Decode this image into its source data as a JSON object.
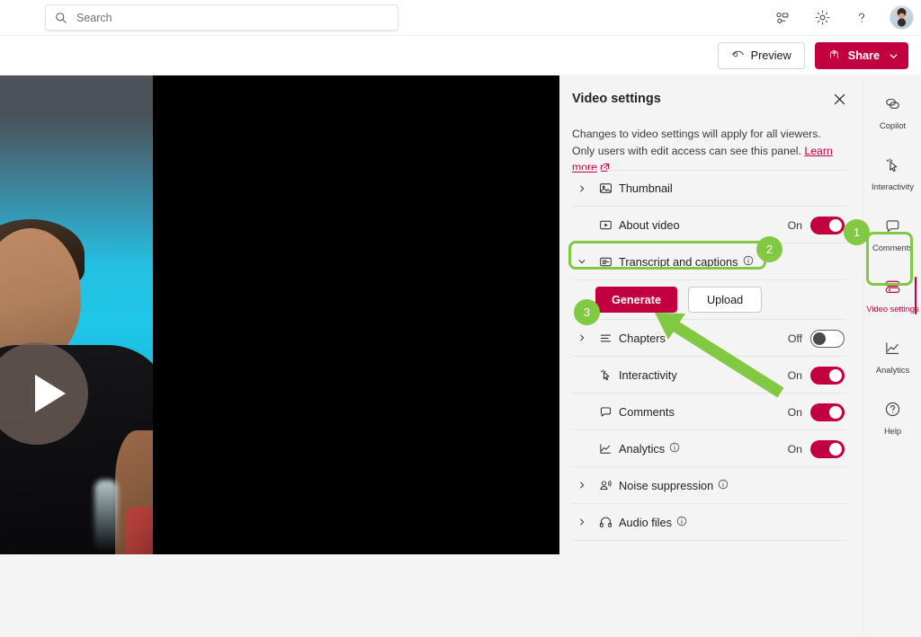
{
  "suitebar": {
    "search": {
      "placeholder": "Search",
      "value": "",
      "icon": "search-icon"
    },
    "actions": [
      {
        "name": "share-people-icon",
        "label": ""
      },
      {
        "name": "settings-gear-icon",
        "label": ""
      },
      {
        "name": "help-question-icon",
        "label": ""
      }
    ],
    "avatar": {
      "name": "user-avatar",
      "label": ""
    }
  },
  "commandbar": {
    "preview_label": "Preview",
    "preview_icon": "eye-icon",
    "share_label": "Share",
    "share_icon": "share-icon",
    "share_chevron": "chevron-down-icon"
  },
  "player": {
    "play_icon": "play-icon"
  },
  "panel": {
    "title": "Video settings",
    "close_icon": "close-icon",
    "description_part1": "Changes to video settings will apply for all viewers. Only users with edit access can see this panel.",
    "learn_more": "Learn more",
    "learn_more_icon": "open-in-new-icon",
    "rows": [
      {
        "id": "thumbnail",
        "label": "Thumbnail",
        "icon": "image-icon",
        "expandable": true,
        "expanded": false,
        "chevron": "chevron-right-icon",
        "info": false,
        "state": null
      },
      {
        "id": "about-video",
        "label": "About video",
        "icon": "play-box-icon",
        "expandable": false,
        "expanded": false,
        "chevron": null,
        "info": false,
        "state": "On",
        "toggle": "on"
      },
      {
        "id": "transcript-and-captions",
        "label": "Transcript and captions",
        "icon": "transcript-icon",
        "expandable": true,
        "expanded": true,
        "chevron": "chevron-down-icon",
        "info": true,
        "state": null
      },
      {
        "id": "chapters",
        "label": "Chapters",
        "icon": "chapters-icon",
        "expandable": true,
        "expanded": false,
        "chevron": "chevron-right-icon",
        "info": false,
        "state": "Off",
        "toggle": "off"
      },
      {
        "id": "interactivity",
        "label": "Interactivity",
        "icon": "interactivity-icon",
        "expandable": false,
        "expanded": false,
        "chevron": null,
        "info": false,
        "state": "On",
        "toggle": "on"
      },
      {
        "id": "comments",
        "label": "Comments",
        "icon": "comment-icon",
        "expandable": false,
        "expanded": false,
        "chevron": null,
        "info": false,
        "state": "On",
        "toggle": "on"
      },
      {
        "id": "analytics",
        "label": "Analytics",
        "icon": "analytics-icon",
        "expandable": false,
        "expanded": false,
        "chevron": null,
        "info": true,
        "state": "On",
        "toggle": "on"
      },
      {
        "id": "noise-suppression",
        "label": "Noise suppression",
        "icon": "noise-suppression-icon",
        "expandable": true,
        "expanded": false,
        "chevron": "chevron-right-icon",
        "info": true,
        "state": null
      },
      {
        "id": "audio-files",
        "label": "Audio files",
        "icon": "headphones-icon",
        "expandable": true,
        "expanded": false,
        "chevron": "chevron-right-icon",
        "info": true,
        "state": null
      }
    ],
    "transcript_actions": {
      "generate_label": "Generate",
      "upload_label": "Upload"
    }
  },
  "rail": {
    "items": [
      {
        "id": "copilot",
        "label": "Copilot",
        "icon": "copilot-icon",
        "selected": false
      },
      {
        "id": "interactivity",
        "label": "Interactivity",
        "icon": "interactivity-icon",
        "selected": false
      },
      {
        "id": "comments",
        "label": "Comments",
        "icon": "comment-icon",
        "selected": false
      },
      {
        "id": "video-settings",
        "label": "Video settings",
        "icon": "video-settings-icon",
        "selected": true
      },
      {
        "id": "analytics",
        "label": "Analytics",
        "icon": "analytics-icon",
        "selected": false
      },
      {
        "id": "help",
        "label": "Help",
        "icon": "help-circle-icon",
        "selected": false
      }
    ]
  },
  "annotations": {
    "highlight_color": "#82c943",
    "accent_color": "#c3003f",
    "badges": [
      {
        "id": "step-1",
        "number": "1"
      },
      {
        "id": "step-2",
        "number": "2"
      },
      {
        "id": "step-3",
        "number": "3"
      }
    ]
  }
}
